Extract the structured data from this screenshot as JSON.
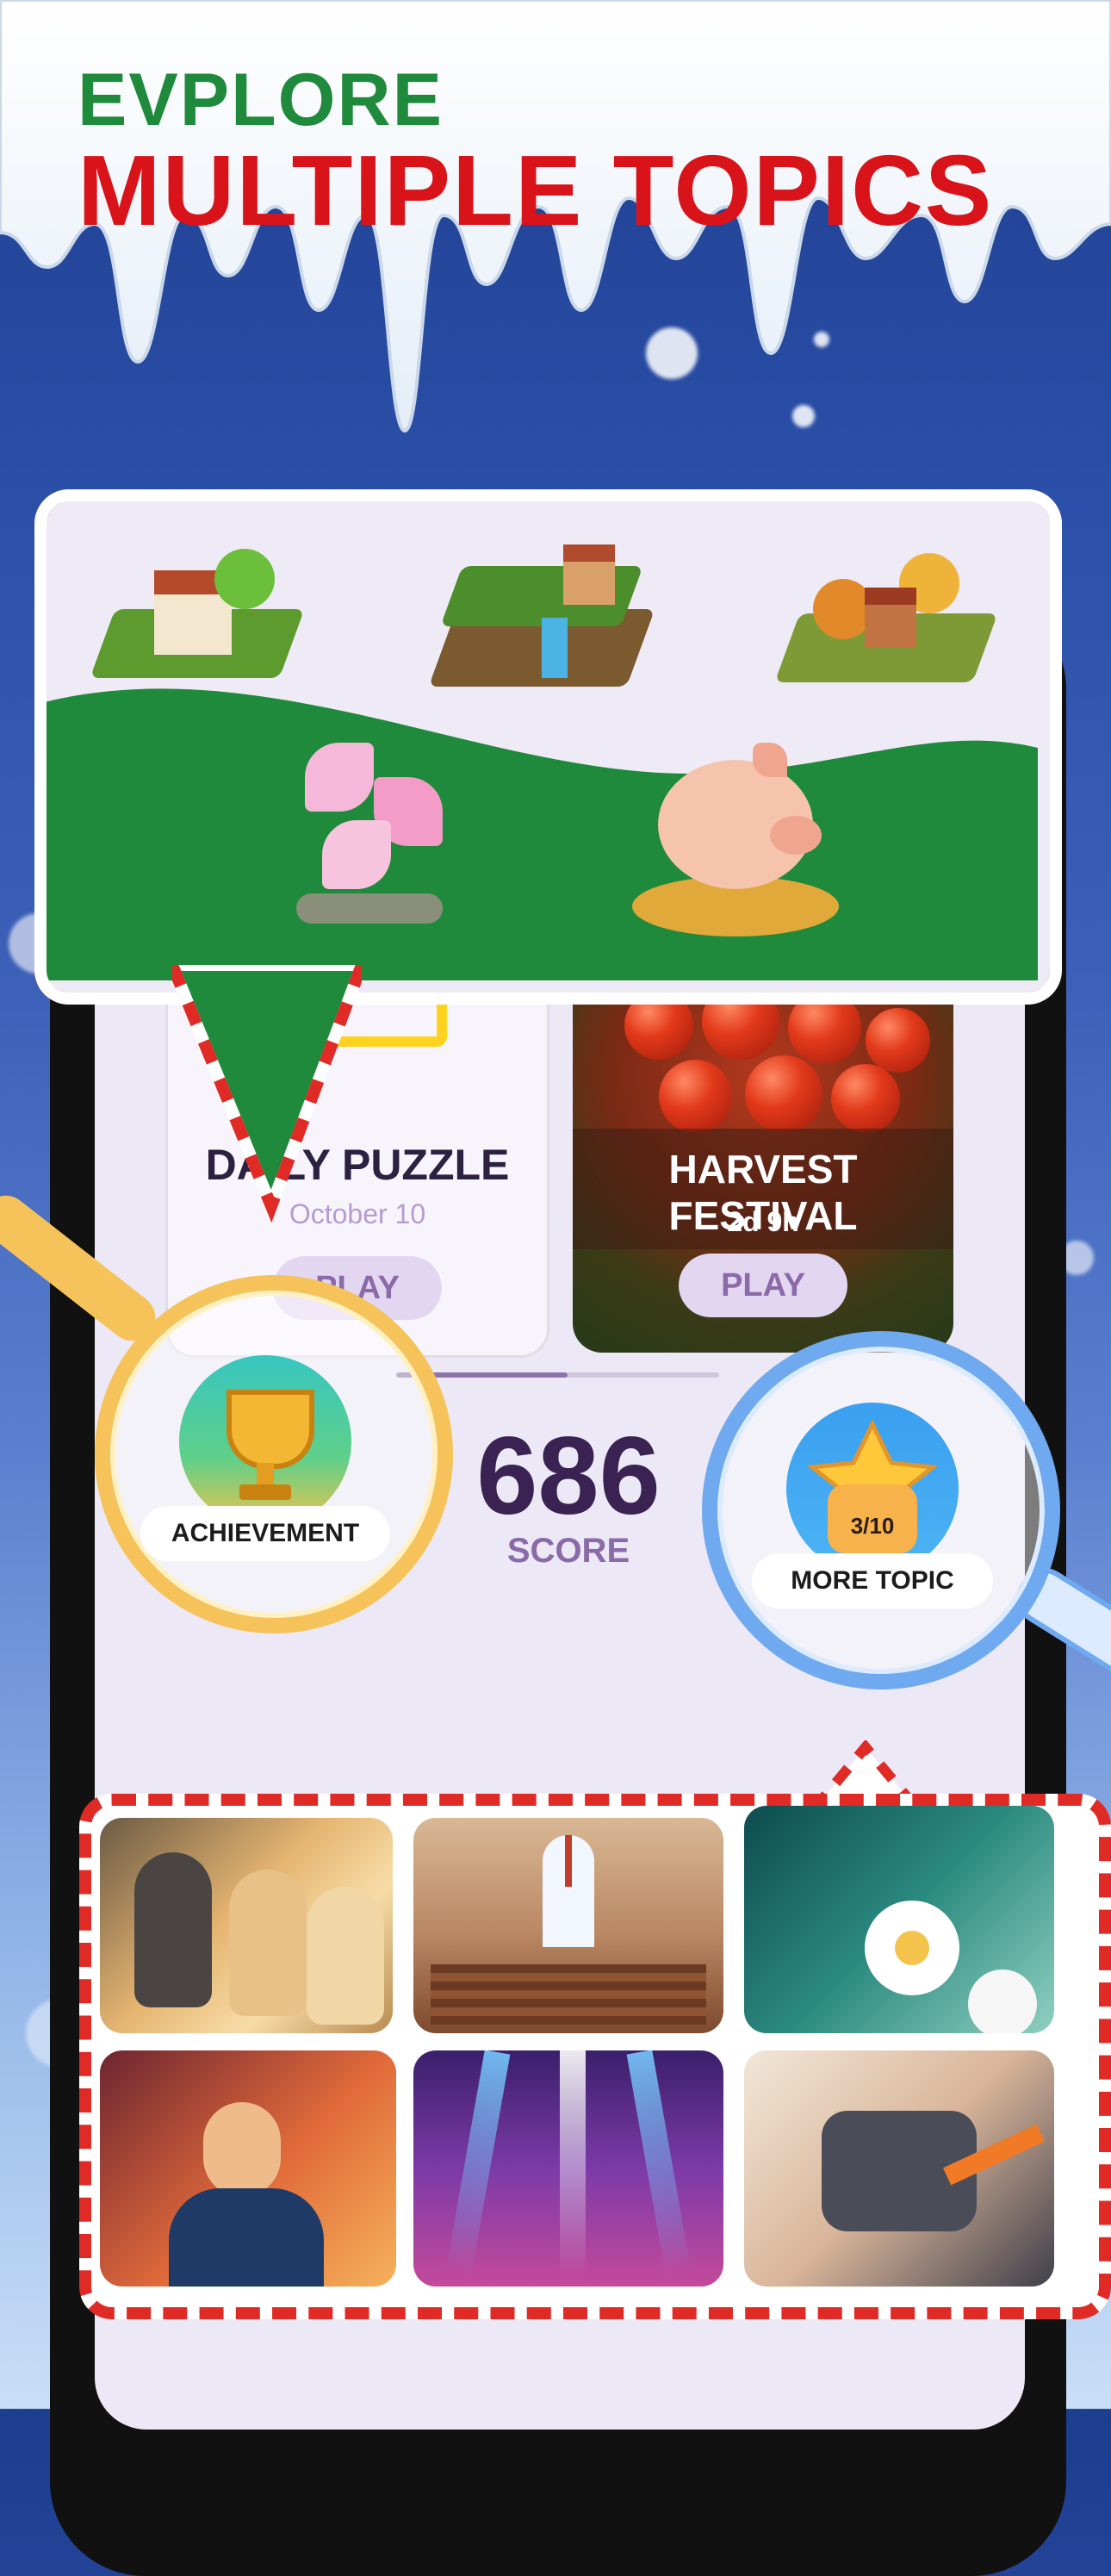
{
  "headline": {
    "line1": "EVPLORE",
    "line2": "MULTIPLE TOPICS"
  },
  "topics_popover": {
    "items": [
      "farmhouse-island",
      "waterfall-village-island",
      "autumn-village-island",
      "lily-flowers",
      "piggy-bank-coins"
    ]
  },
  "cards": {
    "daily": {
      "title": "DAILY PUZZLE",
      "date": "October 10",
      "play": "PLAY"
    },
    "harvest": {
      "title": "HARVEST FESTIVAL",
      "countdown": "2d 9h",
      "play": "PLAY"
    }
  },
  "progress": {
    "fraction": 0.53
  },
  "score": {
    "value": "686",
    "label": "SCORE"
  },
  "achievement": {
    "label": "ACHIEVEMENT"
  },
  "more_topic": {
    "count": "3/10",
    "label": "MORE TOPIC"
  },
  "topic_grid": {
    "tiles": [
      "dogs",
      "cathedral",
      "daisies",
      "singer",
      "concert-stage",
      "robot"
    ]
  },
  "colors": {
    "accent_green": "#1f8a3b",
    "accent_red": "#d8141a",
    "score_purple": "#3a2352"
  }
}
